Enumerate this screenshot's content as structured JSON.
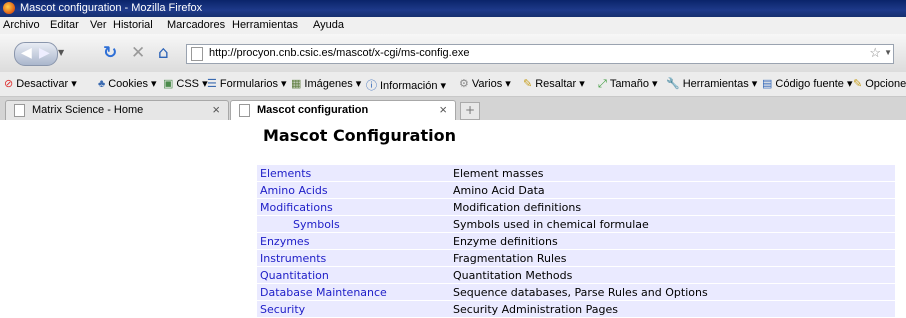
{
  "window": {
    "title": "Mascot configuration - Mozilla Firefox"
  },
  "menu": [
    "Archivo",
    "Editar",
    "Ver",
    "Historial",
    "Marcadores",
    "Herramientas",
    "Ayuda"
  ],
  "address": {
    "url": "http://procyon.cnb.csic.es/mascot/x-cgi/ms-config.exe"
  },
  "bookmarks": [
    {
      "label": "Desactivar",
      "icon": "no-entry-icon"
    },
    {
      "label": "Cookies",
      "icon": "cookie-icon"
    },
    {
      "label": "CSS",
      "icon": "css-icon"
    },
    {
      "label": "Formularios",
      "icon": "form-icon"
    },
    {
      "label": "Imágenes",
      "icon": "image-icon"
    },
    {
      "label": "Información",
      "icon": "info-icon"
    },
    {
      "label": "Varios",
      "icon": "gear-icon"
    },
    {
      "label": "Resaltar",
      "icon": "pencil-icon"
    },
    {
      "label": "Tamaño",
      "icon": "resize-icon"
    },
    {
      "label": "Herramientas",
      "icon": "wrench-icon"
    },
    {
      "label": "Código fuente",
      "icon": "source-icon"
    },
    {
      "label": "Opcione",
      "icon": "options-icon"
    }
  ],
  "tabs": [
    {
      "label": "Matrix Science - Home",
      "active": false
    },
    {
      "label": "Mascot configuration",
      "active": true
    }
  ],
  "page": {
    "heading": "Mascot Configuration",
    "rows": [
      {
        "link": "Elements",
        "desc": "Element masses"
      },
      {
        "link": "Amino Acids",
        "desc": "Amino Acid Data"
      },
      {
        "link": "Modifications",
        "desc": "Modification definitions"
      },
      {
        "link": "Symbols",
        "desc": "Symbols used in chemical formulae"
      },
      {
        "link": "Enzymes",
        "desc": "Enzyme definitions"
      },
      {
        "link": "Instruments",
        "desc": "Fragmentation Rules"
      },
      {
        "link": "Quantitation",
        "desc": "Quantitation Methods"
      },
      {
        "link": "Database Maintenance",
        "desc": "Sequence databases, Parse Rules and Options"
      },
      {
        "link": "Security",
        "desc": "Security Administration Pages"
      }
    ]
  },
  "colors": {
    "link": "#2020c8",
    "row_bg": "#eaeaff",
    "titlebar": "#0a246a"
  }
}
